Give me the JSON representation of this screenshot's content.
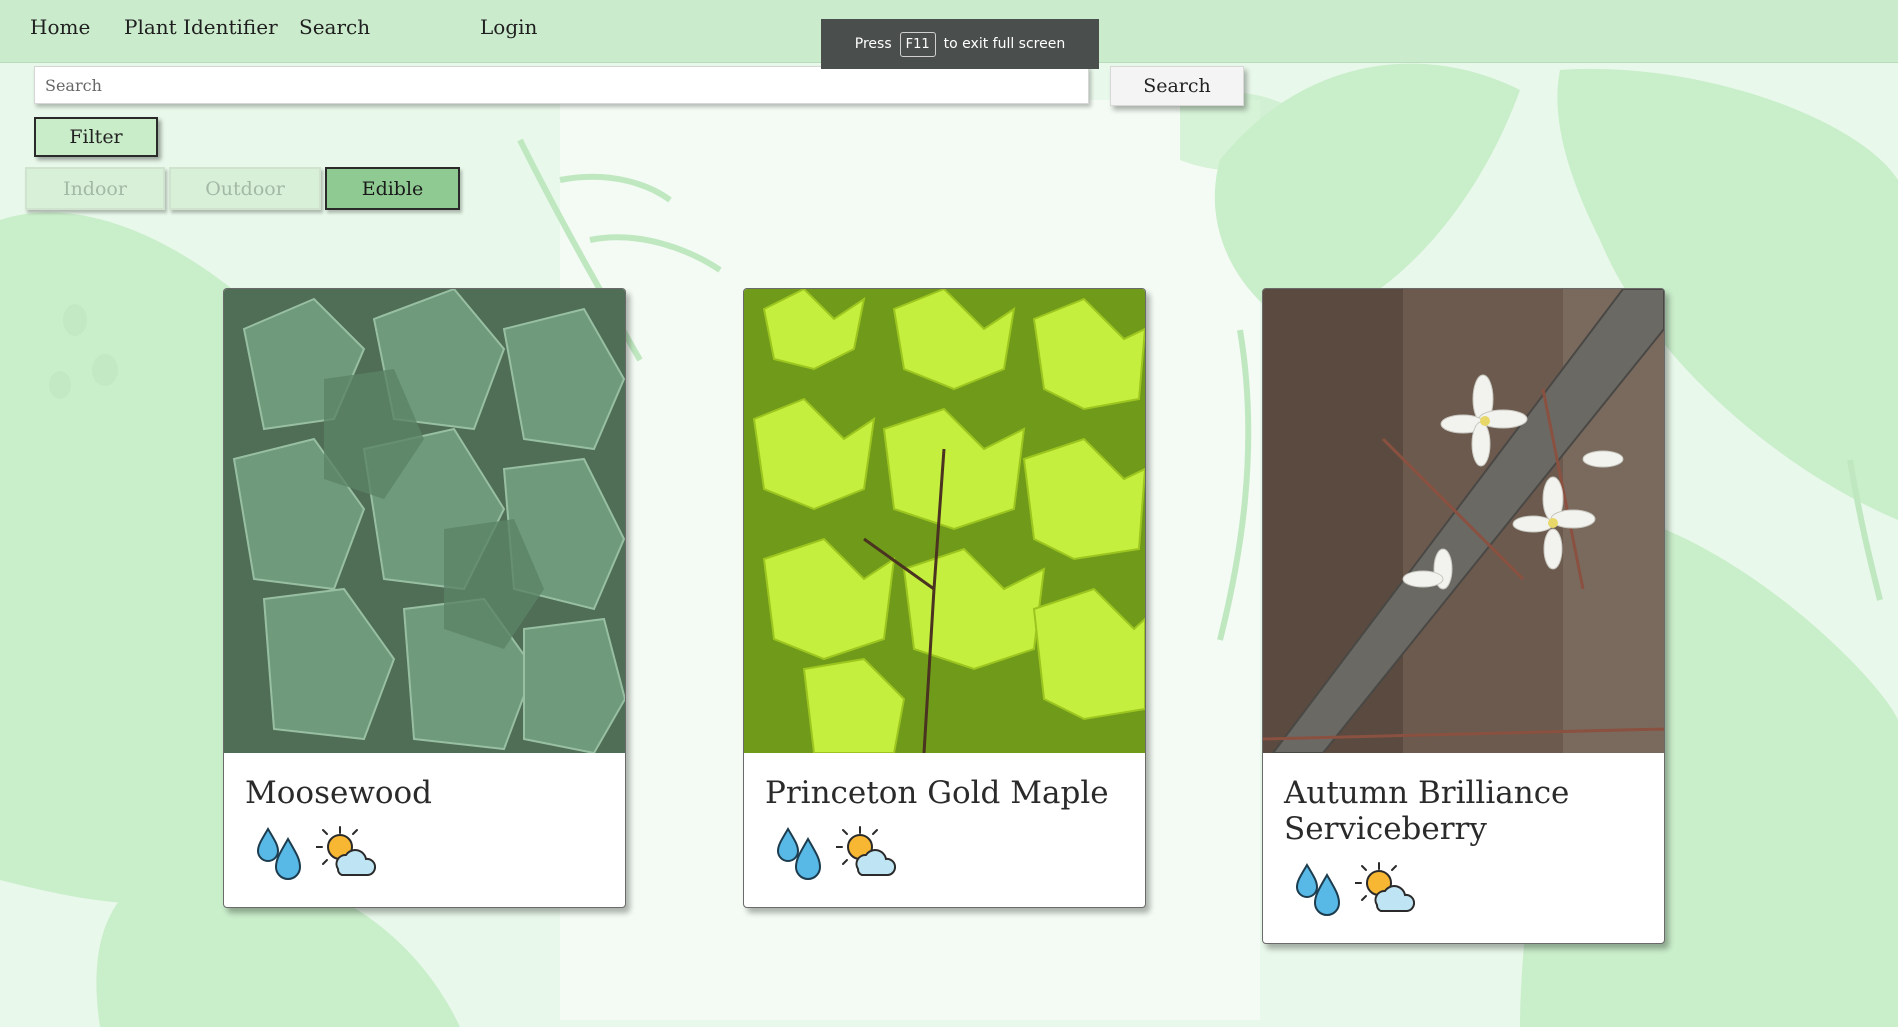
{
  "nav": {
    "home": "Home",
    "plant_identifier": "Plant Identifier",
    "search": "Search",
    "login": "Login"
  },
  "fullscreen_notice": {
    "press": "Press",
    "key": "F11",
    "message": "to exit full screen"
  },
  "search": {
    "placeholder": "Search",
    "button_label": "Search"
  },
  "filter": {
    "button_label": "Filter",
    "chips": [
      {
        "label": "Indoor",
        "active": false
      },
      {
        "label": "Outdoor",
        "active": false
      },
      {
        "label": "Edible",
        "active": true
      }
    ]
  },
  "plants": [
    {
      "name": "Moosewood",
      "icons": [
        "water-drops-icon",
        "partly-sunny-icon"
      ]
    },
    {
      "name": "Princeton Gold Maple",
      "icons": [
        "water-drops-icon",
        "partly-sunny-icon"
      ]
    },
    {
      "name": "Autumn Brilliance Serviceberry",
      "icons": [
        "water-drops-icon",
        "partly-sunny-icon"
      ]
    }
  ],
  "colors": {
    "navbar": "#cbeccc",
    "background": "#e6f7e9",
    "chip_active": "#8fca92",
    "leaf_deco": "#c8eec9"
  }
}
